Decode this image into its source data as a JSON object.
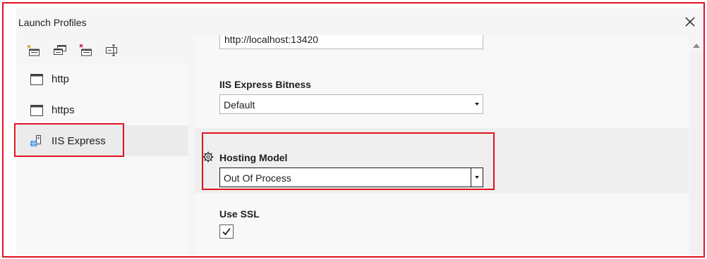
{
  "dialog": {
    "title": "Launch Profiles",
    "close_icon": "close-icon"
  },
  "toolbar": {
    "buttons": [
      {
        "icon": "new-profile-icon"
      },
      {
        "icon": "copy-profile-icon"
      },
      {
        "icon": "delete-profile-icon"
      },
      {
        "icon": "rename-profile-icon"
      }
    ]
  },
  "profiles": [
    {
      "label": "http",
      "icon": "window-icon",
      "selected": false
    },
    {
      "label": "https",
      "icon": "window-icon",
      "selected": false
    },
    {
      "label": "IIS Express",
      "icon": "iis-express-icon",
      "selected": true
    }
  ],
  "settings": {
    "url_value": "http://localhost:13420",
    "bitness": {
      "label": "IIS Express Bitness",
      "value": "Default"
    },
    "hosting_model": {
      "label": "Hosting Model",
      "value": "Out Of Process",
      "icon": "gear-icon"
    },
    "use_ssl": {
      "label": "Use SSL",
      "checked": true
    }
  },
  "colors": {
    "highlight_border": "#e0121f",
    "background": "#f5f5f5",
    "panel": "#f8f8f8",
    "selected_item": "#ebebeb"
  }
}
